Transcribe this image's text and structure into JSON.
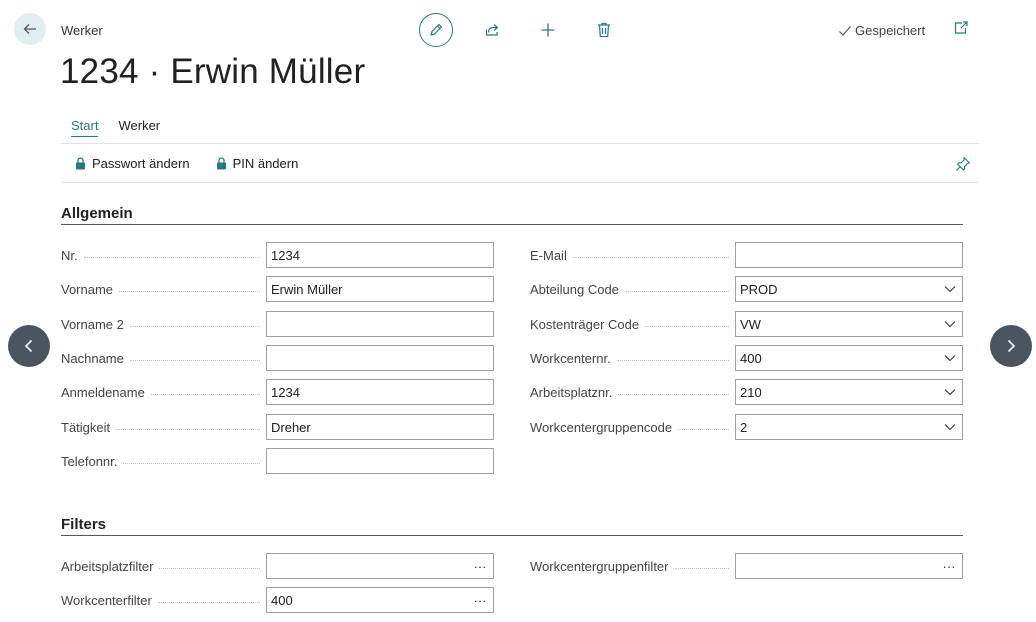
{
  "header": {
    "breadcrumb": "Werker",
    "title": "1234 · Erwin Müller",
    "saved_status": "Gespeichert",
    "icons": [
      "back-arrow-icon",
      "edit-pencil-icon",
      "share-icon",
      "plus-icon",
      "trash-icon",
      "checkmark-icon",
      "popout-icon"
    ]
  },
  "actionbar": {
    "tabs": [
      {
        "label": "Start",
        "active": true
      },
      {
        "label": "Werker",
        "active": false
      }
    ],
    "actions": [
      {
        "label": "Passwort ändern",
        "icon": "lock-icon"
      },
      {
        "label": "PIN ändern",
        "icon": "lock-icon"
      }
    ],
    "pin_icon": "pin-icon"
  },
  "sections": {
    "allgemein": {
      "title": "Allgemein",
      "left": [
        {
          "label": "Nr.",
          "value": "1234",
          "type": "text"
        },
        {
          "label": "Vorname",
          "value": "Erwin Müller",
          "type": "text"
        },
        {
          "label": "Vorname 2",
          "value": "",
          "type": "text"
        },
        {
          "label": "Nachname",
          "value": "",
          "type": "text"
        },
        {
          "label": "Anmeldename",
          "value": "1234",
          "type": "text"
        },
        {
          "label": "Tätigkeit",
          "value": "Dreher",
          "type": "text"
        },
        {
          "label": "Telefonnr.",
          "value": "",
          "type": "text"
        }
      ],
      "right": [
        {
          "label": "E-Mail",
          "value": "",
          "type": "text"
        },
        {
          "label": "Abteilung Code",
          "value": "PROD",
          "type": "select"
        },
        {
          "label": "Kostenträger Code",
          "value": "VW",
          "type": "select"
        },
        {
          "label": "Workcenternr.",
          "value": "400",
          "type": "select"
        },
        {
          "label": "Arbeitsplatznr.",
          "value": "210",
          "type": "select"
        },
        {
          "label": "Workcentergruppencode",
          "value": "2",
          "type": "select"
        }
      ]
    },
    "filters": {
      "title": "Filters",
      "left": [
        {
          "label": "Arbeitsplatzfilter",
          "value": "",
          "type": "lookup"
        },
        {
          "label": "Workcenterfilter",
          "value": "400",
          "type": "lookup"
        }
      ],
      "right": [
        {
          "label": "Workcentergruppenfilter",
          "value": "",
          "type": "lookup"
        }
      ]
    }
  },
  "lookup_glyph": "···",
  "nav": {
    "prev_icon": "chevron-left-icon",
    "next_icon": "chevron-right-icon"
  },
  "colors": {
    "accent": "#2a7a7c",
    "back_bg": "#dfeeee",
    "nav_bg": "#4b5560"
  }
}
